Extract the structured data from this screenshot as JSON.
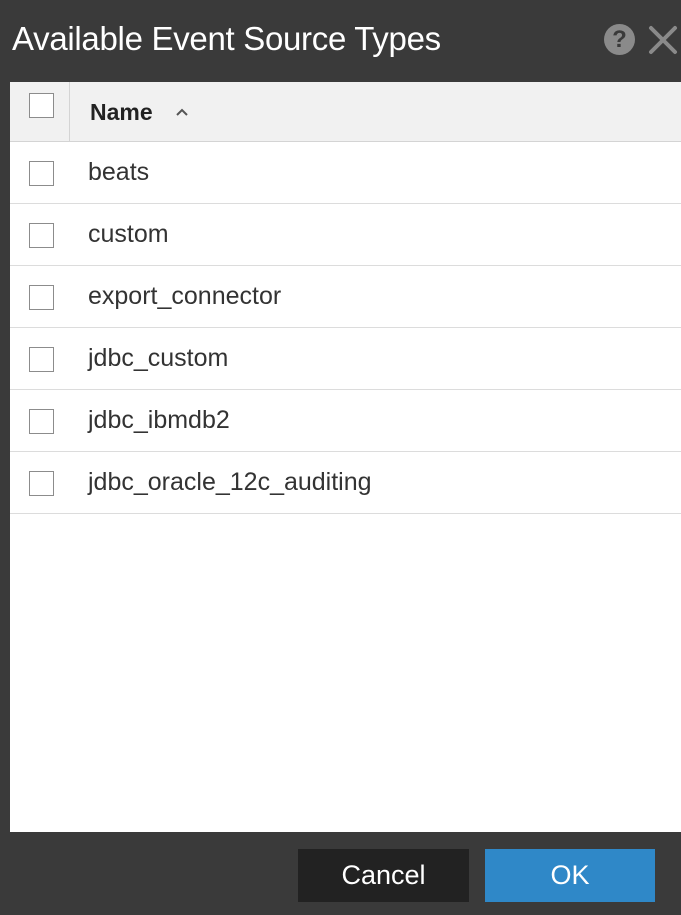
{
  "dialog": {
    "title": "Available Event Source Types",
    "help_icon": "question-circle-icon",
    "help_glyph": "?",
    "close_icon": "close-x-icon"
  },
  "table": {
    "columns": [
      {
        "label": "Name",
        "sort": "ascending",
        "sort_icon": "chevron-up-icon"
      }
    ],
    "rows": [
      {
        "name": "beats",
        "checked": false
      },
      {
        "name": "custom",
        "checked": false
      },
      {
        "name": "export_connector",
        "checked": false
      },
      {
        "name": "jdbc_custom",
        "checked": false
      },
      {
        "name": "jdbc_ibmdb2",
        "checked": false
      },
      {
        "name": "jdbc_oracle_12c_auditing",
        "checked": false
      }
    ],
    "select_all_checked": false
  },
  "footer": {
    "cancel_label": "Cancel",
    "ok_label": "OK"
  },
  "colors": {
    "chrome": "#3a3a3a",
    "primary_button": "#2f88c8",
    "secondary_button": "#222222"
  }
}
